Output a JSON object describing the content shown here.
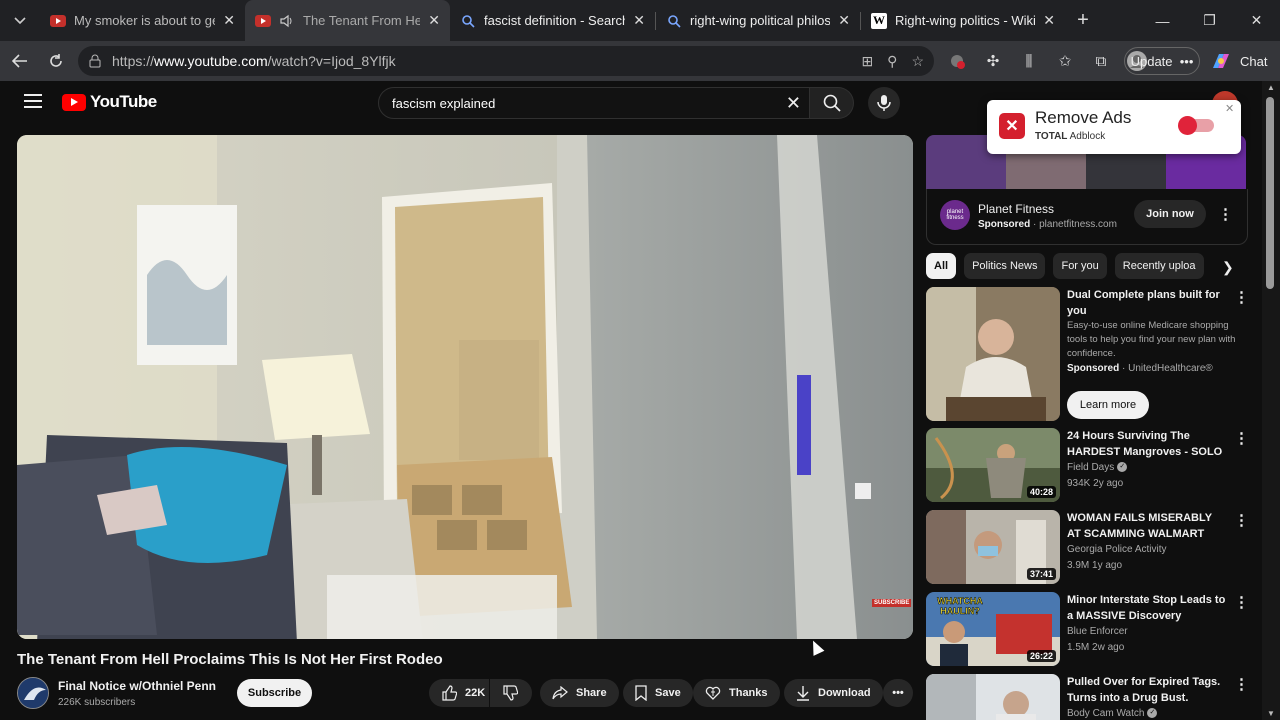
{
  "browser": {
    "tabs": [
      {
        "title": "My smoker is about to get a",
        "favicon": "youtube-icon",
        "active": false
      },
      {
        "title": "The Tenant From Hell P",
        "favicon": "youtube-audio-icon",
        "active": true
      },
      {
        "title": "fascist definition - Search",
        "favicon": "search-icon",
        "active": false
      },
      {
        "title": "right-wing political philosop",
        "favicon": "search-icon",
        "active": false
      },
      {
        "title": "Right-wing politics - Wikipe",
        "favicon": "wikipedia-icon",
        "active": false
      }
    ],
    "url_prefix": "https://",
    "url_host": "www.youtube.com",
    "url_path": "/watch?v=Ijod_8Ylfjk",
    "update_label": "Update",
    "chat_label": "Chat"
  },
  "youtube": {
    "logo_text": "YouTube",
    "search_value": "fascism explained",
    "video": {
      "title": "The Tenant From Hell Proclaims This Is Not Her First Rodeo",
      "overlay_badge": "SUBSCRIBE"
    },
    "channel": {
      "name": "Final Notice w/Othniel Penn",
      "subscribers": "226K subscribers",
      "subscribe_label": "Subscribe"
    },
    "actions": {
      "likes": "22K",
      "share": "Share",
      "save": "Save",
      "thanks": "Thanks",
      "download": "Download"
    },
    "ad": {
      "logo_text": "planet fitness",
      "name": "Planet Fitness",
      "sponsored": "Sponsored",
      "domain": "planetfitness.com",
      "cta": "Join now"
    },
    "chips": [
      "All",
      "Politics News",
      "For you",
      "Recently uploa"
    ],
    "recommendations": [
      {
        "title": "Dual Complete plans built for you",
        "description": "Easy-to-use online Medicare shopping tools to help you find your new plan with confidence.",
        "sponsored": "Sponsored",
        "advertiser": "UnitedHealthcare®",
        "cta": "Learn more"
      },
      {
        "title": "24 Hours Surviving The HARDEST Mangroves - SOLO ...",
        "channel": "Field Days",
        "meta": "934K  2y ago",
        "duration": "40:28"
      },
      {
        "title": "WOMAN FAILS MISERABLY AT SCAMMING WALMART FOR ...",
        "channel": "Georgia Police Activity",
        "meta": "3.9M  1y ago",
        "duration": "37:41"
      },
      {
        "title": "Minor Interstate Stop Leads to a MASSIVE Discovery",
        "channel": "Blue Enforcer",
        "meta": "1.5M  2w ago",
        "duration": "26:22",
        "thumb_text": "WHATCHA HAULIN?"
      },
      {
        "title": "Pulled Over for Expired Tags. Turns into a Drug Bust.",
        "channel": "Body Cam Watch"
      }
    ]
  },
  "adblock": {
    "title": "Remove Ads",
    "brand_bold": "TOTAL",
    "brand_rest": " Adblock"
  },
  "colors": {
    "youtube_red": "#ff0000",
    "background": "#0f0f0f",
    "adblock_red": "#e0233a"
  }
}
